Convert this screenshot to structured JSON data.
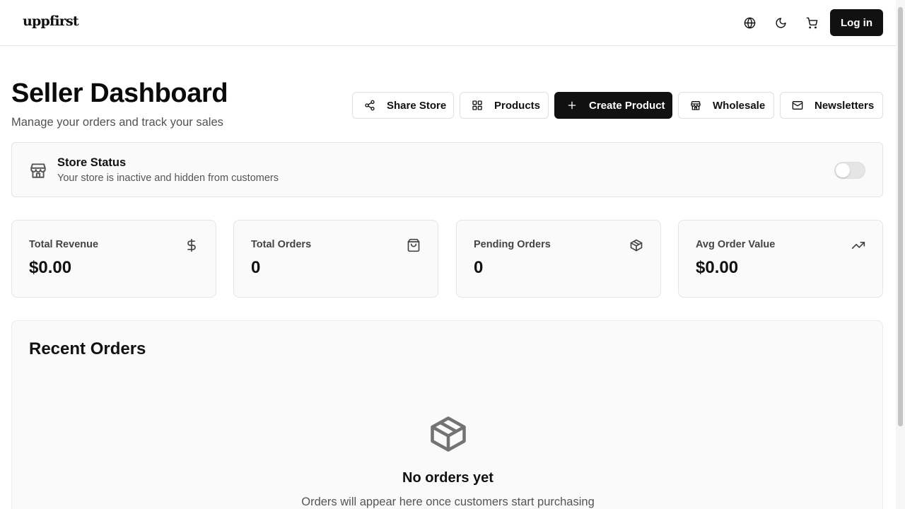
{
  "nav": {
    "logo": "uppfirst",
    "icons": [
      "globe-icon",
      "moon-icon",
      "cart-icon"
    ],
    "login_label": "Log in"
  },
  "header": {
    "title": "Seller Dashboard",
    "subtitle": "Manage your orders and track your sales"
  },
  "actions": [
    {
      "label": "Share Store",
      "icon": "share-icon",
      "primary": false
    },
    {
      "label": "Products",
      "icon": "grid-icon",
      "primary": false
    },
    {
      "label": "Create Product",
      "icon": "plus-icon",
      "primary": true
    },
    {
      "label": "Wholesale",
      "icon": "store-icon",
      "primary": false
    },
    {
      "label": "Newsletters",
      "icon": "mail-icon",
      "primary": false
    }
  ],
  "store_status": {
    "title": "Store Status",
    "description": "Your store is inactive and hidden from customers",
    "active": false,
    "icon": "store-icon"
  },
  "stats": [
    {
      "label": "Total Revenue",
      "value": "$0.00",
      "icon": "dollar-icon"
    },
    {
      "label": "Total Orders",
      "value": "0",
      "icon": "shopping-bag-icon"
    },
    {
      "label": "Pending Orders",
      "value": "0",
      "icon": "package-icon"
    },
    {
      "label": "Avg Order Value",
      "value": "$0.00",
      "icon": "trending-up-icon"
    }
  ],
  "orders": {
    "title": "Recent Orders",
    "empty_title": "No orders yet",
    "empty_description": "Orders will appear here once customers start purchasing",
    "empty_icon": "package-icon"
  },
  "colors": {
    "primary": "#111111",
    "muted_text": "#525252",
    "border": "#e5e5e5",
    "card_bg": "#fafafa"
  }
}
